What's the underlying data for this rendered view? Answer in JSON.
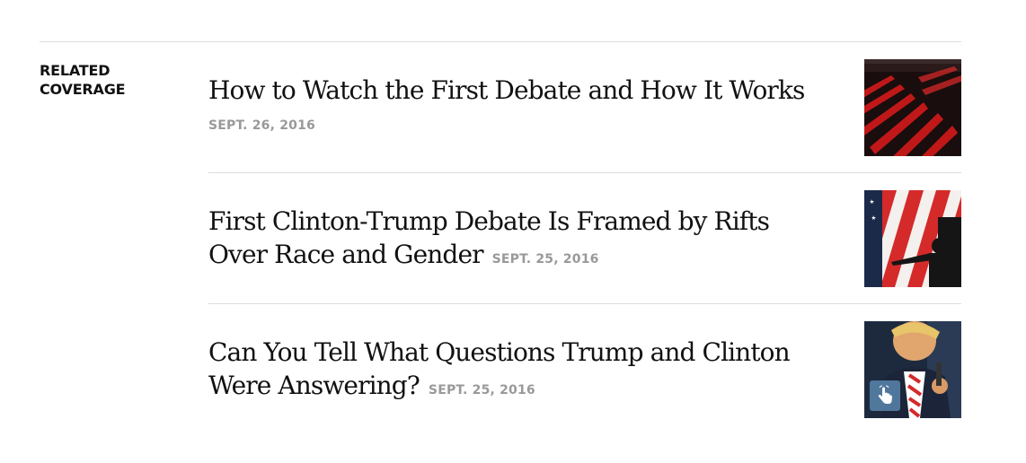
{
  "section": {
    "label_line1": "RELATED",
    "label_line2": "COVERAGE"
  },
  "items": [
    {
      "headline": "How to Watch the First Debate and How It Works",
      "date": "SEPT. 26, 2016",
      "thumb_icon": "debate-hall-seats-thumbnail"
    },
    {
      "headline": "First Clinton-Trump Debate Is Framed by Rifts Over Race and Gender",
      "date": "SEPT. 25, 2016",
      "thumb_icon": "american-flag-silhouette-thumbnail"
    },
    {
      "headline": "Can You Tell What Questions Trump and Clinton Were Answering?",
      "date": "SEPT. 25, 2016",
      "thumb_icon": "trump-portrait-thumbnail",
      "badge_icon": "interactive-hand-icon"
    }
  ],
  "colors": {
    "date_gray": "#999999",
    "rule_gray": "#dcdcdc",
    "badge_blue": "#5882aa"
  }
}
